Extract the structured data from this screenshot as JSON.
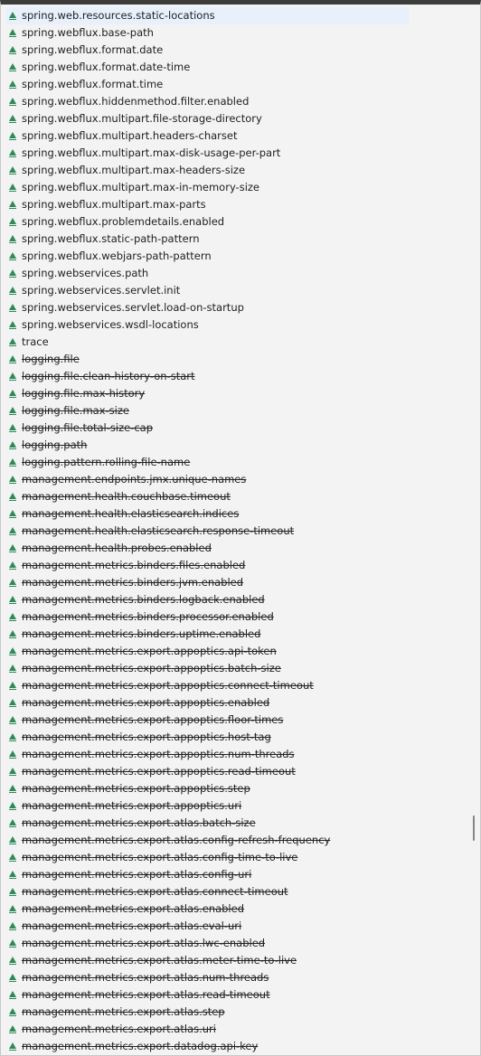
{
  "suggestions": [
    {
      "label": "spring.web.resources.static-locations",
      "deprecated": false,
      "selected": true,
      "icon": "property-icon"
    },
    {
      "label": "spring.webflux.base-path",
      "deprecated": false,
      "icon": "property-icon"
    },
    {
      "label": "spring.webflux.format.date",
      "deprecated": false,
      "icon": "property-icon"
    },
    {
      "label": "spring.webflux.format.date-time",
      "deprecated": false,
      "icon": "property-icon"
    },
    {
      "label": "spring.webflux.format.time",
      "deprecated": false,
      "icon": "property-icon"
    },
    {
      "label": "spring.webflux.hiddenmethod.filter.enabled",
      "deprecated": false,
      "icon": "property-icon"
    },
    {
      "label": "spring.webflux.multipart.file-storage-directory",
      "deprecated": false,
      "icon": "property-icon"
    },
    {
      "label": "spring.webflux.multipart.headers-charset",
      "deprecated": false,
      "icon": "property-icon"
    },
    {
      "label": "spring.webflux.multipart.max-disk-usage-per-part",
      "deprecated": false,
      "icon": "property-icon"
    },
    {
      "label": "spring.webflux.multipart.max-headers-size",
      "deprecated": false,
      "icon": "property-icon"
    },
    {
      "label": "spring.webflux.multipart.max-in-memory-size",
      "deprecated": false,
      "icon": "property-icon"
    },
    {
      "label": "spring.webflux.multipart.max-parts",
      "deprecated": false,
      "icon": "property-icon"
    },
    {
      "label": "spring.webflux.problemdetails.enabled",
      "deprecated": false,
      "icon": "property-icon"
    },
    {
      "label": "spring.webflux.static-path-pattern",
      "deprecated": false,
      "icon": "property-icon"
    },
    {
      "label": "spring.webflux.webjars-path-pattern",
      "deprecated": false,
      "icon": "property-icon"
    },
    {
      "label": "spring.webservices.path",
      "deprecated": false,
      "icon": "property-icon"
    },
    {
      "label": "spring.webservices.servlet.init",
      "deprecated": false,
      "icon": "property-icon"
    },
    {
      "label": "spring.webservices.servlet.load-on-startup",
      "deprecated": false,
      "icon": "property-icon"
    },
    {
      "label": "spring.webservices.wsdl-locations",
      "deprecated": false,
      "icon": "property-icon"
    },
    {
      "label": "trace",
      "deprecated": false,
      "icon": "property-icon"
    },
    {
      "label": "logging.file",
      "deprecated": true,
      "icon": "property-icon"
    },
    {
      "label": "logging.file.clean-history-on-start",
      "deprecated": true,
      "icon": "property-icon"
    },
    {
      "label": "logging.file.max-history",
      "deprecated": true,
      "icon": "property-icon"
    },
    {
      "label": "logging.file.max-size",
      "deprecated": true,
      "icon": "property-icon"
    },
    {
      "label": "logging.file.total-size-cap",
      "deprecated": true,
      "icon": "property-icon"
    },
    {
      "label": "logging.path",
      "deprecated": true,
      "icon": "property-icon"
    },
    {
      "label": "logging.pattern.rolling-file-name",
      "deprecated": true,
      "icon": "property-icon"
    },
    {
      "label": "management.endpoints.jmx.unique-names",
      "deprecated": true,
      "icon": "property-icon"
    },
    {
      "label": "management.health.couchbase.timeout",
      "deprecated": true,
      "icon": "property-icon"
    },
    {
      "label": "management.health.elasticsearch.indices",
      "deprecated": true,
      "icon": "property-icon"
    },
    {
      "label": "management.health.elasticsearch.response-timeout",
      "deprecated": true,
      "icon": "property-icon"
    },
    {
      "label": "management.health.probes.enabled",
      "deprecated": true,
      "icon": "property-icon"
    },
    {
      "label": "management.metrics.binders.files.enabled",
      "deprecated": true,
      "icon": "property-icon"
    },
    {
      "label": "management.metrics.binders.jvm.enabled",
      "deprecated": true,
      "icon": "property-icon"
    },
    {
      "label": "management.metrics.binders.logback.enabled",
      "deprecated": true,
      "icon": "property-icon"
    },
    {
      "label": "management.metrics.binders.processor.enabled",
      "deprecated": true,
      "icon": "property-icon"
    },
    {
      "label": "management.metrics.binders.uptime.enabled",
      "deprecated": true,
      "icon": "property-icon"
    },
    {
      "label": "management.metrics.export.appoptics.api-token",
      "deprecated": true,
      "icon": "property-icon"
    },
    {
      "label": "management.metrics.export.appoptics.batch-size",
      "deprecated": true,
      "icon": "property-icon"
    },
    {
      "label": "management.metrics.export.appoptics.connect-timeout",
      "deprecated": true,
      "icon": "property-icon"
    },
    {
      "label": "management.metrics.export.appoptics.enabled",
      "deprecated": true,
      "icon": "property-icon"
    },
    {
      "label": "management.metrics.export.appoptics.floor-times",
      "deprecated": true,
      "icon": "property-icon"
    },
    {
      "label": "management.metrics.export.appoptics.host-tag",
      "deprecated": true,
      "icon": "property-icon"
    },
    {
      "label": "management.metrics.export.appoptics.num-threads",
      "deprecated": true,
      "icon": "property-icon"
    },
    {
      "label": "management.metrics.export.appoptics.read-timeout",
      "deprecated": true,
      "icon": "property-icon"
    },
    {
      "label": "management.metrics.export.appoptics.step",
      "deprecated": true,
      "icon": "property-icon"
    },
    {
      "label": "management.metrics.export.appoptics.uri",
      "deprecated": true,
      "icon": "property-icon"
    },
    {
      "label": "management.metrics.export.atlas.batch-size",
      "deprecated": true,
      "icon": "property-icon"
    },
    {
      "label": "management.metrics.export.atlas.config-refresh-frequency",
      "deprecated": true,
      "icon": "property-icon"
    },
    {
      "label": "management.metrics.export.atlas.config-time-to-live",
      "deprecated": true,
      "icon": "property-icon"
    },
    {
      "label": "management.metrics.export.atlas.config-uri",
      "deprecated": true,
      "icon": "property-icon"
    },
    {
      "label": "management.metrics.export.atlas.connect-timeout",
      "deprecated": true,
      "icon": "property-icon"
    },
    {
      "label": "management.metrics.export.atlas.enabled",
      "deprecated": true,
      "icon": "property-icon"
    },
    {
      "label": "management.metrics.export.atlas.eval-uri",
      "deprecated": true,
      "icon": "property-icon"
    },
    {
      "label": "management.metrics.export.atlas.lwc-enabled",
      "deprecated": true,
      "icon": "property-icon"
    },
    {
      "label": "management.metrics.export.atlas.meter-time-to-live",
      "deprecated": true,
      "icon": "property-icon"
    },
    {
      "label": "management.metrics.export.atlas.num-threads",
      "deprecated": true,
      "icon": "property-icon"
    },
    {
      "label": "management.metrics.export.atlas.read-timeout",
      "deprecated": true,
      "icon": "property-icon"
    },
    {
      "label": "management.metrics.export.atlas.step",
      "deprecated": true,
      "icon": "property-icon"
    },
    {
      "label": "management.metrics.export.atlas.uri",
      "deprecated": true,
      "icon": "property-icon"
    },
    {
      "label": "management.metrics.export.datadog.api-key",
      "deprecated": true,
      "icon": "property-icon"
    }
  ],
  "colors": {
    "background": "#f3f3f3",
    "selected_row": "#e8f0fc",
    "icon": "#2e8b57",
    "text": "#1e1e1e",
    "scrollbar_thumb": "#858585"
  },
  "scrollbar": {
    "position_fraction": 0.77
  }
}
